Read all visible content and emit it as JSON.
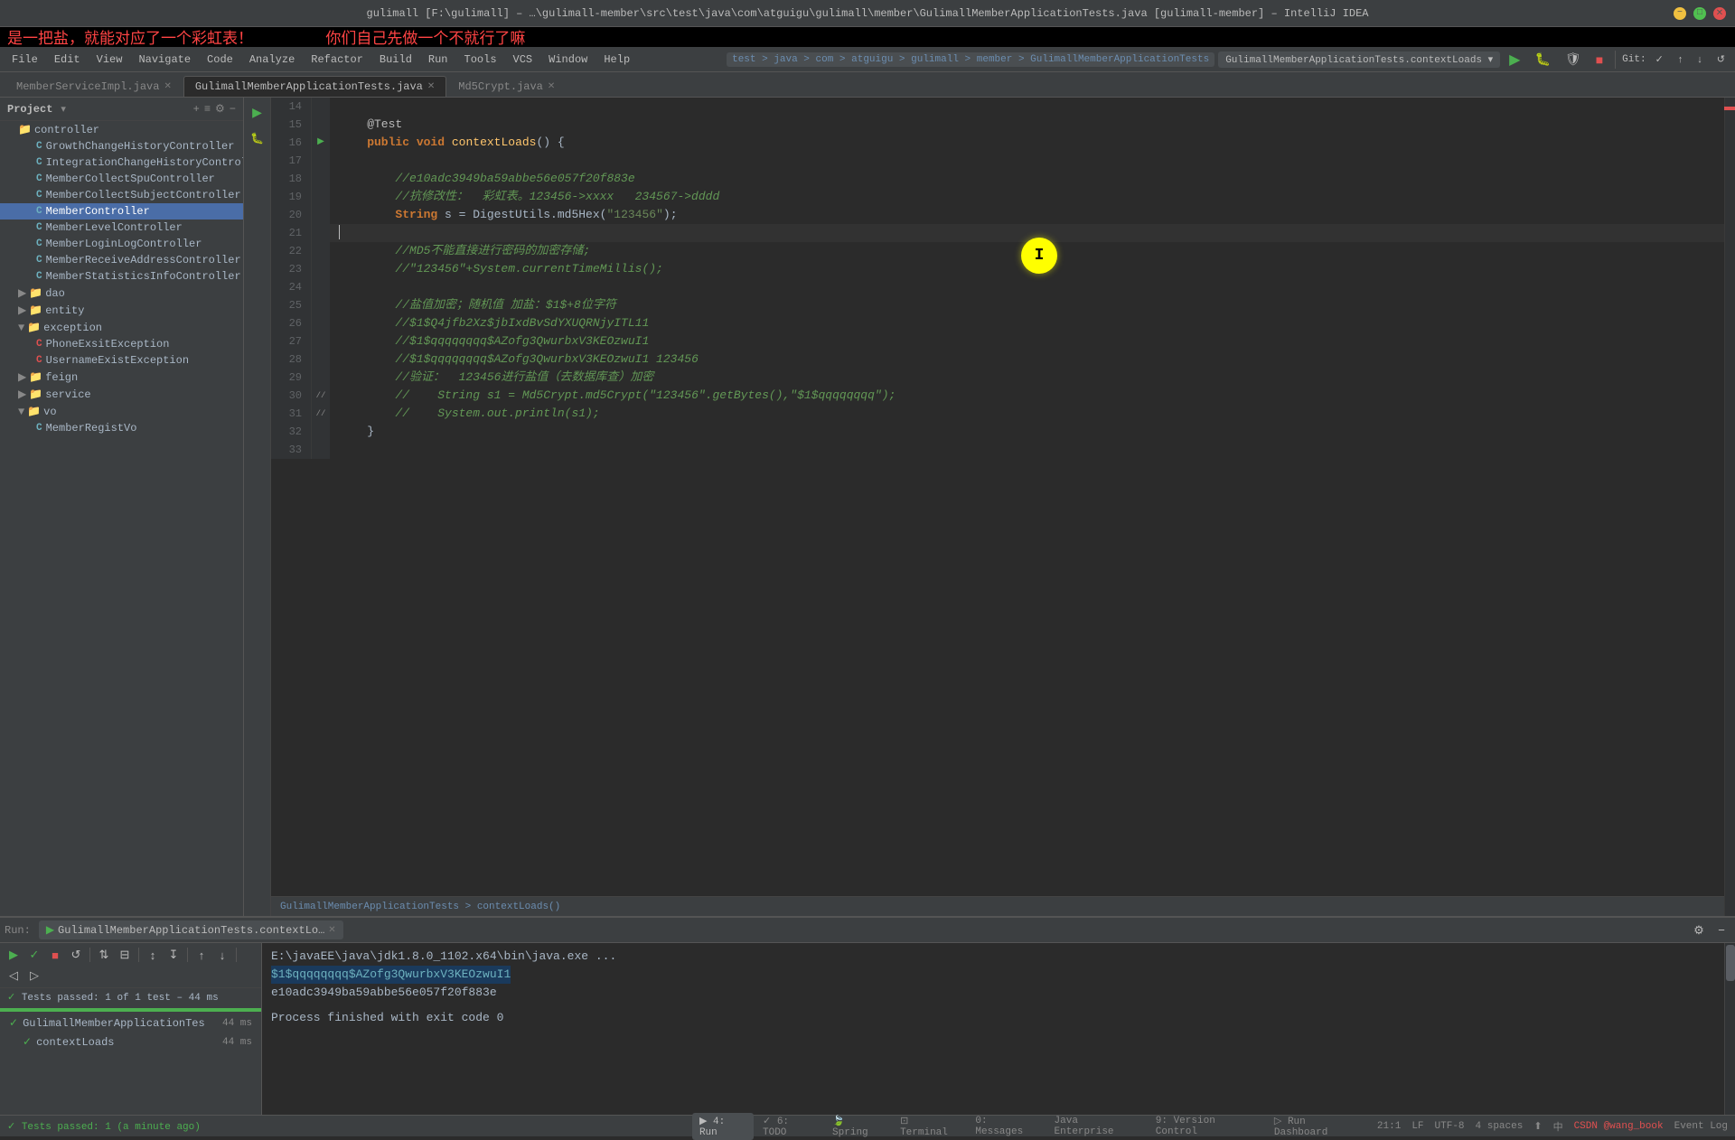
{
  "titleBar": {
    "title": "gulimall [F:\\gulimall] – …\\gulimall-member\\src\\test\\java\\com\\atguigu\\gulimall\\member\\GulimallMemberApplicationTests.java [gulimall-member] – IntelliJ IDEA",
    "minimize": "−",
    "maximize": "□",
    "close": "✕"
  },
  "annotation": {
    "line1": "是一把盐，就能对应了一个彩虹表！",
    "line2": "你们自己先做一个不就行了嘛"
  },
  "menuBar": {
    "items": [
      "File",
      "Edit",
      "View",
      "Navigate",
      "Code",
      "Analyze",
      "Refactor",
      "Build",
      "Run",
      "Tools",
      "VCS",
      "Window",
      "Help"
    ]
  },
  "breadcrumb": {
    "parts": [
      "test",
      "java",
      "com",
      "atguigu",
      "gulimall",
      "member",
      "GulimallMemberApplicationTests"
    ]
  },
  "runConfig": {
    "label": "GulimallMemberApplicationTests.contextLoads",
    "dropdownArrow": "▾"
  },
  "tabs": [
    {
      "id": "tab-member-service",
      "label": "MemberServiceImpl.java",
      "closable": true
    },
    {
      "id": "tab-test",
      "label": "GulimallMemberApplicationTests.java",
      "closable": true,
      "active": true
    },
    {
      "id": "tab-md5",
      "label": "Md5Crypt.java",
      "closable": true
    }
  ],
  "sidebar": {
    "projectLabel": "Project",
    "tree": [
      {
        "id": "item-controller",
        "label": "controller",
        "type": "folder",
        "indent": 1,
        "expanded": true
      },
      {
        "id": "item-growth",
        "label": "GrowthChangeHistoryController",
        "type": "class",
        "indent": 2
      },
      {
        "id": "item-integration",
        "label": "IntegrationChangeHistoryController",
        "type": "class",
        "indent": 2
      },
      {
        "id": "item-collect-spu",
        "label": "MemberCollectSpuController",
        "type": "class",
        "indent": 2
      },
      {
        "id": "item-collect-subject",
        "label": "MemberCollectSubjectController",
        "type": "class",
        "indent": 2
      },
      {
        "id": "item-member",
        "label": "MemberController",
        "type": "class",
        "indent": 2,
        "active": true
      },
      {
        "id": "item-level",
        "label": "MemberLevelController",
        "type": "class",
        "indent": 2
      },
      {
        "id": "item-login-log",
        "label": "MemberLoginLogController",
        "type": "class",
        "indent": 2
      },
      {
        "id": "item-receive-addr",
        "label": "MemberReceiveAddressController",
        "type": "class",
        "indent": 2
      },
      {
        "id": "item-stats",
        "label": "MemberStatisticsInfoController",
        "type": "class",
        "indent": 2
      },
      {
        "id": "item-dao",
        "label": "dao",
        "type": "folder",
        "indent": 1
      },
      {
        "id": "item-entity",
        "label": "entity",
        "type": "folder",
        "indent": 1
      },
      {
        "id": "item-exception",
        "label": "exception",
        "type": "folder",
        "indent": 1,
        "expanded": true
      },
      {
        "id": "item-phone-exc",
        "label": "PhoneExsitException",
        "type": "class-exc",
        "indent": 2
      },
      {
        "id": "item-username-exc",
        "label": "UsernameExistException",
        "type": "class-exc",
        "indent": 2
      },
      {
        "id": "item-feign",
        "label": "feign",
        "type": "folder",
        "indent": 1
      },
      {
        "id": "item-service",
        "label": "service",
        "type": "folder",
        "indent": 1
      },
      {
        "id": "item-vo",
        "label": "vo",
        "type": "folder",
        "indent": 1,
        "expanded": true
      },
      {
        "id": "item-member-regist-vo",
        "label": "MemberRegistVo",
        "type": "class",
        "indent": 2
      }
    ]
  },
  "code": {
    "breadcrumb": "GulimallMemberApplicationTests > contextLoads()",
    "lines": [
      {
        "num": 14,
        "content": "",
        "tokens": []
      },
      {
        "num": 15,
        "content": "    @Test",
        "tokens": [
          {
            "text": "    @Test",
            "cls": "annotation"
          }
        ]
      },
      {
        "num": 16,
        "content": "    public void contextLoads() {",
        "tokens": [
          {
            "text": "    "
          },
          {
            "text": "public ",
            "cls": "kw"
          },
          {
            "text": "void "
          },
          {
            "text": "contextLoads",
            "cls": "method"
          },
          {
            "text": "() {"
          }
        ]
      },
      {
        "num": 17,
        "content": "",
        "tokens": []
      },
      {
        "num": 18,
        "content": "        //e10adc3949ba59abbe56e057f20f883e",
        "tokens": [
          {
            "text": "        //e10adc3949ba59abbe56e057f20f883e",
            "cls": "comment"
          }
        ]
      },
      {
        "num": 19,
        "content": "        //抗修改性：  彩虹表。123456->xxxx   234567->dddd",
        "tokens": [
          {
            "text": "        //抗修改性：  彩虹表。123456->xxxx   234567->dddd",
            "cls": "comment"
          }
        ]
      },
      {
        "num": 20,
        "content": "        String s = DigestUtils.md5Hex(\"123456\");",
        "tokens": [
          {
            "text": "        "
          },
          {
            "text": "String",
            "cls": "kw"
          },
          {
            "text": " s = DigestUtils.md5Hex("
          },
          {
            "text": "\"123456\"",
            "cls": "str"
          },
          {
            "text": ");"
          }
        ]
      },
      {
        "num": 21,
        "content": "",
        "tokens": [],
        "cursor": true
      },
      {
        "num": 22,
        "content": "        //MD5不能直接进行密码的加密存储;",
        "tokens": [
          {
            "text": "        //MD5不能直接进行密码的加密存储;",
            "cls": "comment"
          }
        ]
      },
      {
        "num": 23,
        "content": "        //\"123456\"+System.currentTimeMillis();",
        "tokens": [
          {
            "text": "        //\"123456\"+System.currentTimeMillis();",
            "cls": "comment"
          }
        ]
      },
      {
        "num": 24,
        "content": "",
        "tokens": []
      },
      {
        "num": 25,
        "content": "        //盐值加密；随机值 加盐：$1$+8位字符",
        "tokens": [
          {
            "text": "        //盐值加密；随机值 加盐：$1$+8位字符",
            "cls": "comment"
          }
        ]
      },
      {
        "num": 26,
        "content": "        //$1$Q4jfb2Xz$jbIxdBvSdYXUQRNjyITL11",
        "tokens": [
          {
            "text": "        //$1$Q4jfb2Xz$jbIxdBvSdYXUQRNjyITL11",
            "cls": "comment"
          }
        ]
      },
      {
        "num": 27,
        "content": "        //$1$qqqqqqqq$AZofg3QwurbxV3KEOzwuI1",
        "tokens": [
          {
            "text": "        //$1$qqqqqqqq$AZofg3QwurbxV3KEOzwuI1",
            "cls": "comment"
          }
        ]
      },
      {
        "num": 28,
        "content": "        //$1$qqqqqqqq$AZofg3QwurbxV3KEOzwuI1 123456",
        "tokens": [
          {
            "text": "        //$1$qqqqqqqq$AZofg3QwurbxV3KEOzwuI1 123456",
            "cls": "comment"
          }
        ]
      },
      {
        "num": 29,
        "content": "        //验证：  123456进行盐值（去数据库查）加密",
        "tokens": [
          {
            "text": "        //验证：  123456进行盐值（去数据库查）加密",
            "cls": "comment"
          }
        ]
      },
      {
        "num": 30,
        "content": "        //    String s1 = Md5Crypt.md5Crypt(\"123456\".getBytes(),\"$1$qqqqqqqq\");",
        "tokens": [
          {
            "text": "        //    "
          },
          {
            "text": "String",
            "cls": "kw"
          },
          {
            "text": " s1 = Md5Crypt.md5Crypt("
          },
          {
            "text": "\"123456\"",
            "cls": "str"
          },
          {
            "text": ".getBytes(),"
          },
          {
            "text": "\"$1$qqqqqqqq\"",
            "cls": "str"
          },
          {
            "text": ");"
          }
        ],
        "commented": true
      },
      {
        "num": 31,
        "content": "        //    System.out.println(s1);",
        "tokens": [
          {
            "text": "        //    System.out.println(s1);",
            "cls": "comment"
          }
        ],
        "commented": true
      },
      {
        "num": 32,
        "content": "    }",
        "tokens": [
          {
            "text": "    }"
          }
        ]
      },
      {
        "num": 33,
        "content": "",
        "tokens": []
      }
    ]
  },
  "runPanel": {
    "tabLabel": "Run:",
    "runName": "GulimallMemberApplicationTests.contextLo…",
    "closeLabel": "✕",
    "toolbar": {
      "playBtn": "▶",
      "checkBtn": "✓",
      "stopBtn": "■",
      "rerunBtn": "↺",
      "sortBtn": "⇅",
      "filterBtn": "⊟",
      "expandBtn": "↕",
      "collapseBtn": "↧",
      "upBtn": "↑",
      "downBtn": "↓",
      "prevFailBtn": "◁",
      "nextFailBtn": "▷"
    },
    "statusLine": "✓ Tests passed: 1 of 1 test – 44 ms",
    "testSuite": {
      "label": "GulimallMemberApplicationTes",
      "time": "44 ms",
      "status": "pass",
      "children": [
        {
          "label": "contextLoads",
          "time": "44 ms",
          "status": "pass"
        }
      ]
    },
    "output": {
      "javaCmd": "E:\\javaEE\\java\\jdk1.8.0_1102.x64\\bin\\java.exe ...",
      "salt": "$1$qqqqqqqq$AZofg3QwurbxV3KEOzwuI1",
      "hash": "e10adc3949ba59abbe56e057f20f883e",
      "finish": "Process finished with exit code 0"
    }
  },
  "statusBar": {
    "testsPassed": "✓ Tests passed: 1 (a minute ago)",
    "position": "21:1",
    "lf": "LF",
    "encoding": "UTF-8",
    "indent": "4 spaces",
    "bottomTabs": [
      {
        "id": "tab-run",
        "label": "4: Run"
      },
      {
        "id": "tab-todo",
        "label": "6: TODO"
      },
      {
        "id": "tab-spring",
        "label": "Spring"
      },
      {
        "id": "tab-terminal",
        "label": "Terminal"
      },
      {
        "id": "tab-messages",
        "label": "0: Messages"
      },
      {
        "id": "tab-java-ent",
        "label": "Java Enterprise"
      },
      {
        "id": "tab-version",
        "label": "9: Version Control"
      },
      {
        "id": "tab-run-dash",
        "label": "Run Dashboard"
      }
    ],
    "rightLabel": "Event Log",
    "csdn": "CSDN @wang_book"
  }
}
